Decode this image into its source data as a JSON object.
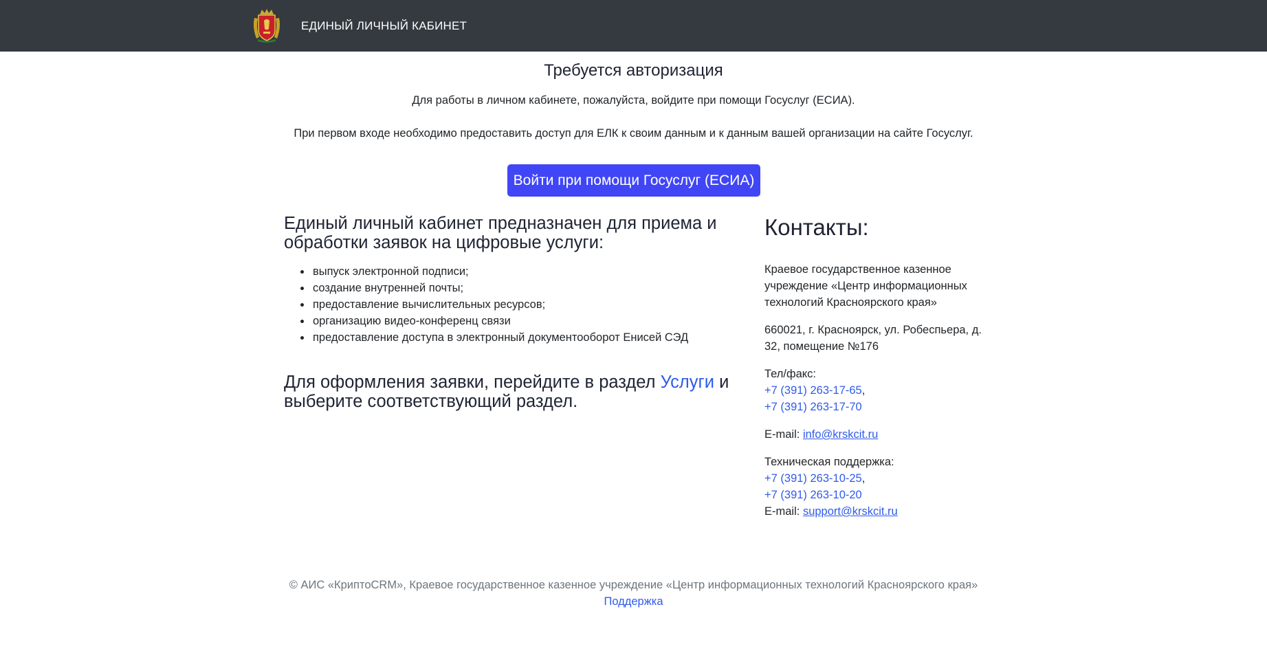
{
  "navbar": {
    "title": "ЕДИНЫЙ ЛИЧНЫЙ КАБИНЕТ",
    "logo_icon": "coat-of-arms-icon",
    "background": "#343a40"
  },
  "auth": {
    "title": "Требуется авторизация",
    "text1": "Для работы в личном кабинете, пожалуйста, войдите при помощи Госуслуг (ЕСИА).",
    "text2": "При первом входе необходимо предоставить доступ для ЕЛК к своим данным и к данным вашей организации на сайте Госуслуг.",
    "button": "Войти при помощи Госуслуг (ЕСИА)",
    "button_color": "#4046f5"
  },
  "about": {
    "heading": "Единый личный кабинет предназначен для приема и обработки заявок на цифровые услуги:",
    "services": [
      "выпуск электронной подписи;",
      "создание внутренней почты;",
      "предоставление вычислительных ресурсов;",
      "организацию видео-конференц связи",
      "предоставление доступа в электронный документооборот Енисей СЭД"
    ],
    "order_prefix": "Для оформления заявки, перейдите в раздел",
    "order_link": "Услуги",
    "order_suffix": "и выберите соответствующий раздел."
  },
  "contacts": {
    "title": "Контакты:",
    "org": "Краевое государственное казенное учреждение «Центр информационных технологий Красноярского края»",
    "address": "660021, г. Красноярск, ул. Робеспьера, д. 32, помещение №176",
    "tel_label": "Тел/факс:",
    "tel1": "+7 (391) 263-17-65",
    "tel2": "+7 (391) 263-17-70",
    "email_label": "E-mail:",
    "email": "info@krskcit.ru",
    "support_label": "Техническая поддержка:",
    "support_tel1": "+7 (391) 263-10-25",
    "support_tel2": "+7 (391) 263-10-20",
    "support_email_label": "E-mail:",
    "support_email": "support@krskcit.ru",
    "link_color": "#2f5bea"
  },
  "footer": {
    "copyright": "© АИС «КриптоCRM», Краевое государственное казенное учреждение «Центр информационных технологий Красноярского края»",
    "support_link": "Поддержка"
  }
}
